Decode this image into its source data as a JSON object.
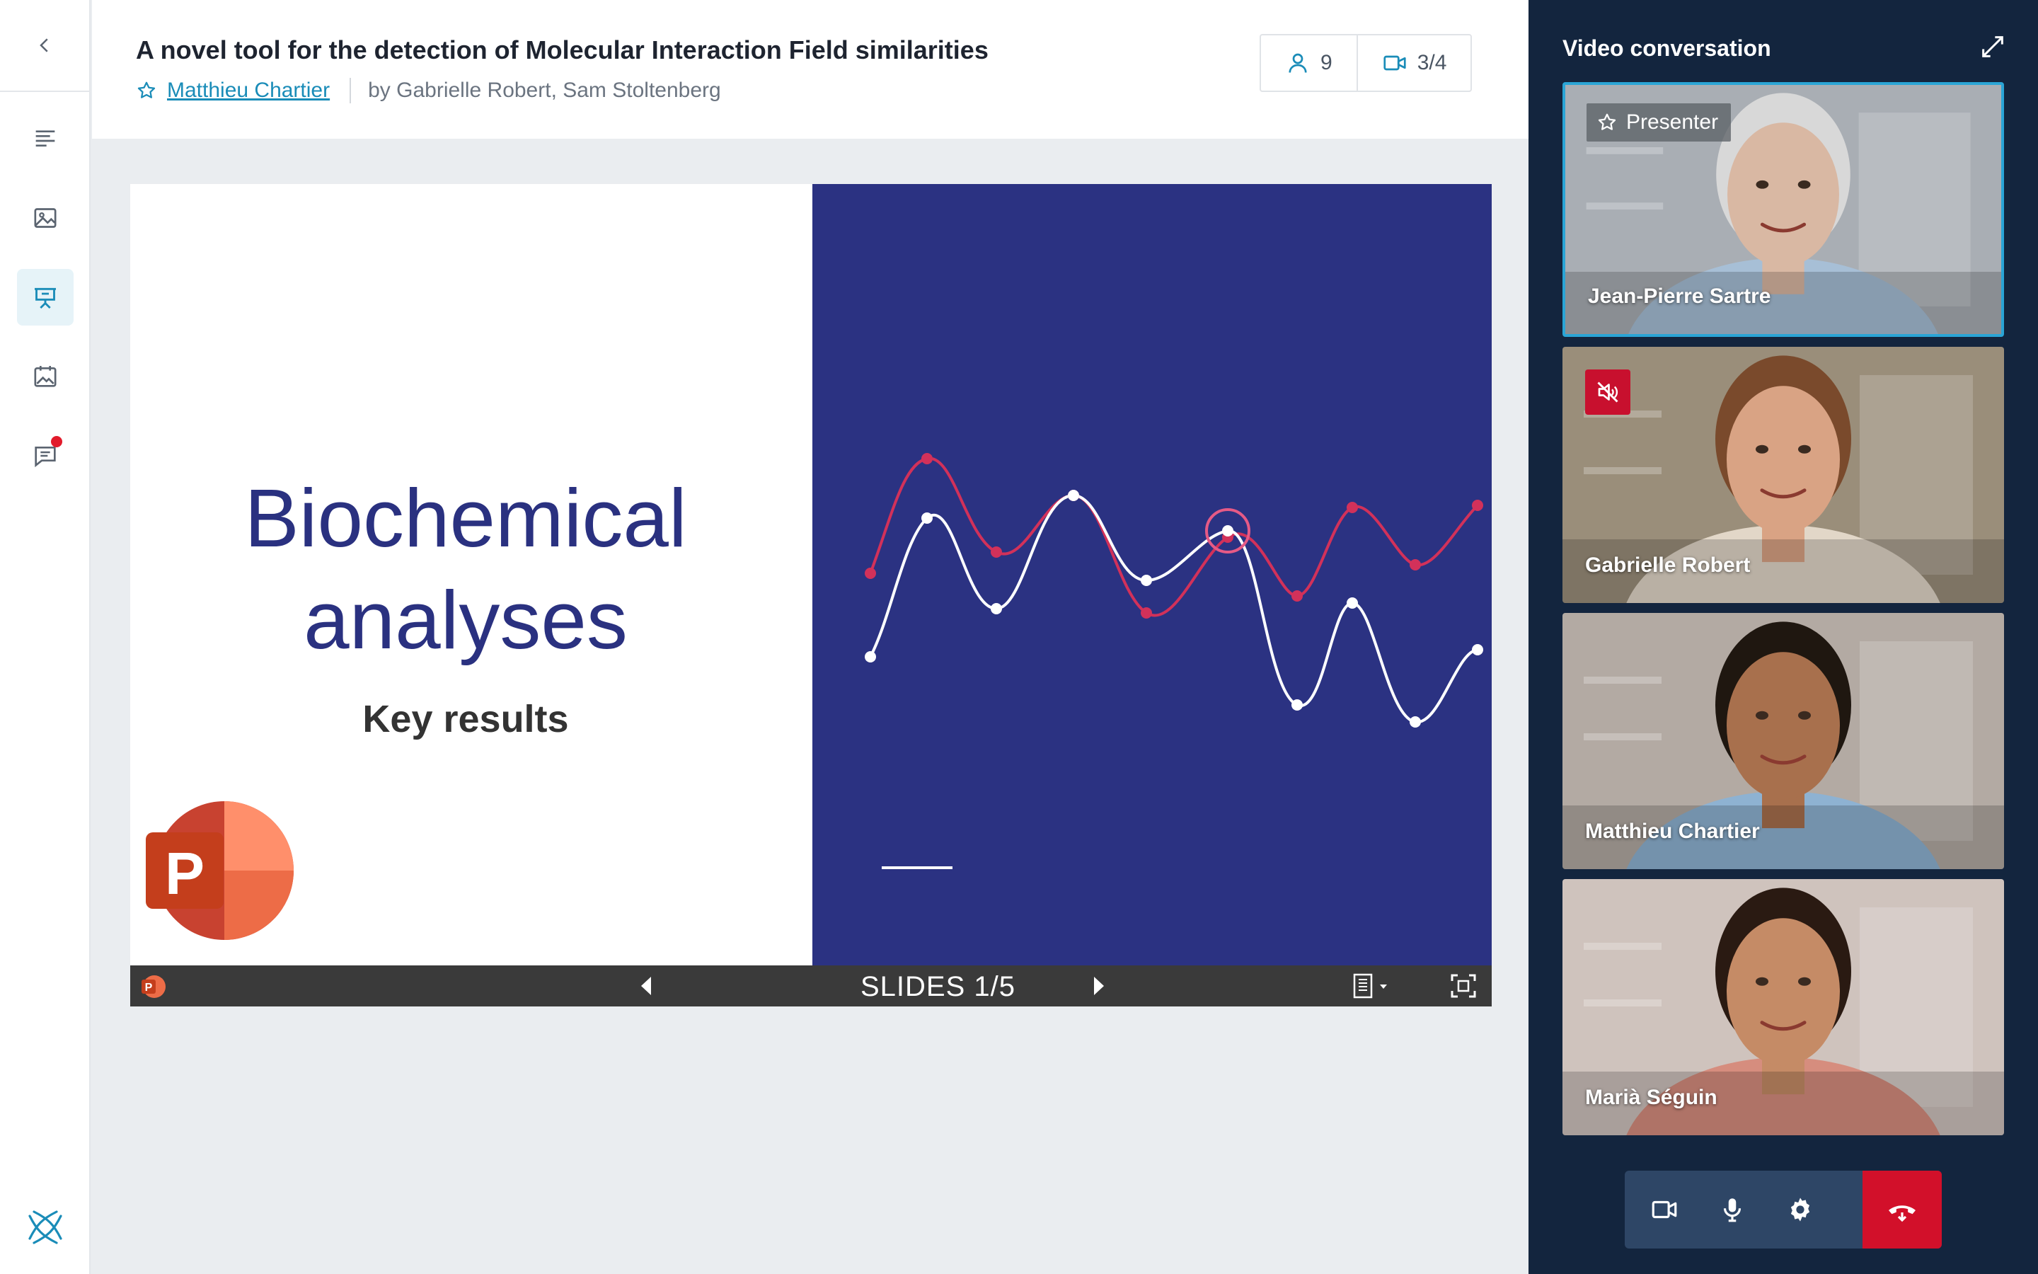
{
  "header": {
    "title": "A novel tool for the detection of Molecular Interaction Field similarities",
    "presenter_link": "Matthieu Chartier",
    "authors": "by Gabrielle Robert, Sam Stoltenberg",
    "participants_count": "9",
    "video_count": "3/4"
  },
  "sidebar": {
    "items": [
      {
        "name": "agenda",
        "icon": "lines-icon"
      },
      {
        "name": "media",
        "icon": "image-icon"
      },
      {
        "name": "presentation",
        "icon": "presentation-board-icon",
        "active": true
      },
      {
        "name": "posters",
        "icon": "calendar-image-icon"
      },
      {
        "name": "chat",
        "icon": "chat-icon",
        "has_notification": true
      }
    ]
  },
  "slide": {
    "heading_line1": "Biochemical",
    "heading_line2": "analyses",
    "subheading": "Key results",
    "colors": {
      "left_bg": "#ffffff",
      "right_bg": "#2b3282",
      "heading": "#2a3180",
      "wave_red": "#d2315a",
      "wave_white": "#ffffff"
    }
  },
  "slide_controls": {
    "label": "SLIDES 1/5"
  },
  "video_panel": {
    "title": "Video conversation",
    "participants": [
      {
        "name": "Jean-Pierre Sartre",
        "role": "Presenter",
        "muted": false,
        "skin": "#d9b8a3",
        "hair": "#d8d8d8",
        "bg": "#a9aeb4",
        "shirt": "#a7bfd6"
      },
      {
        "name": "Gabrielle Robert",
        "role": "",
        "muted": true,
        "skin": "#d9a384",
        "hair": "#7a4a2c",
        "bg": "#9a8e7a",
        "shirt": "#e2d7c8"
      },
      {
        "name": "Matthieu Chartier",
        "role": "",
        "muted": false,
        "skin": "#a8704d",
        "hair": "#1f1710",
        "bg": "#b3aaa3",
        "shirt": "#8eb2d2"
      },
      {
        "name": "Marià Séguin",
        "role": "",
        "muted": false,
        "skin": "#c58b66",
        "hair": "#2a1a12",
        "bg": "#cfc3bd",
        "shirt": "#d68d7e"
      }
    ],
    "presenter_badge_label": "Presenter"
  }
}
